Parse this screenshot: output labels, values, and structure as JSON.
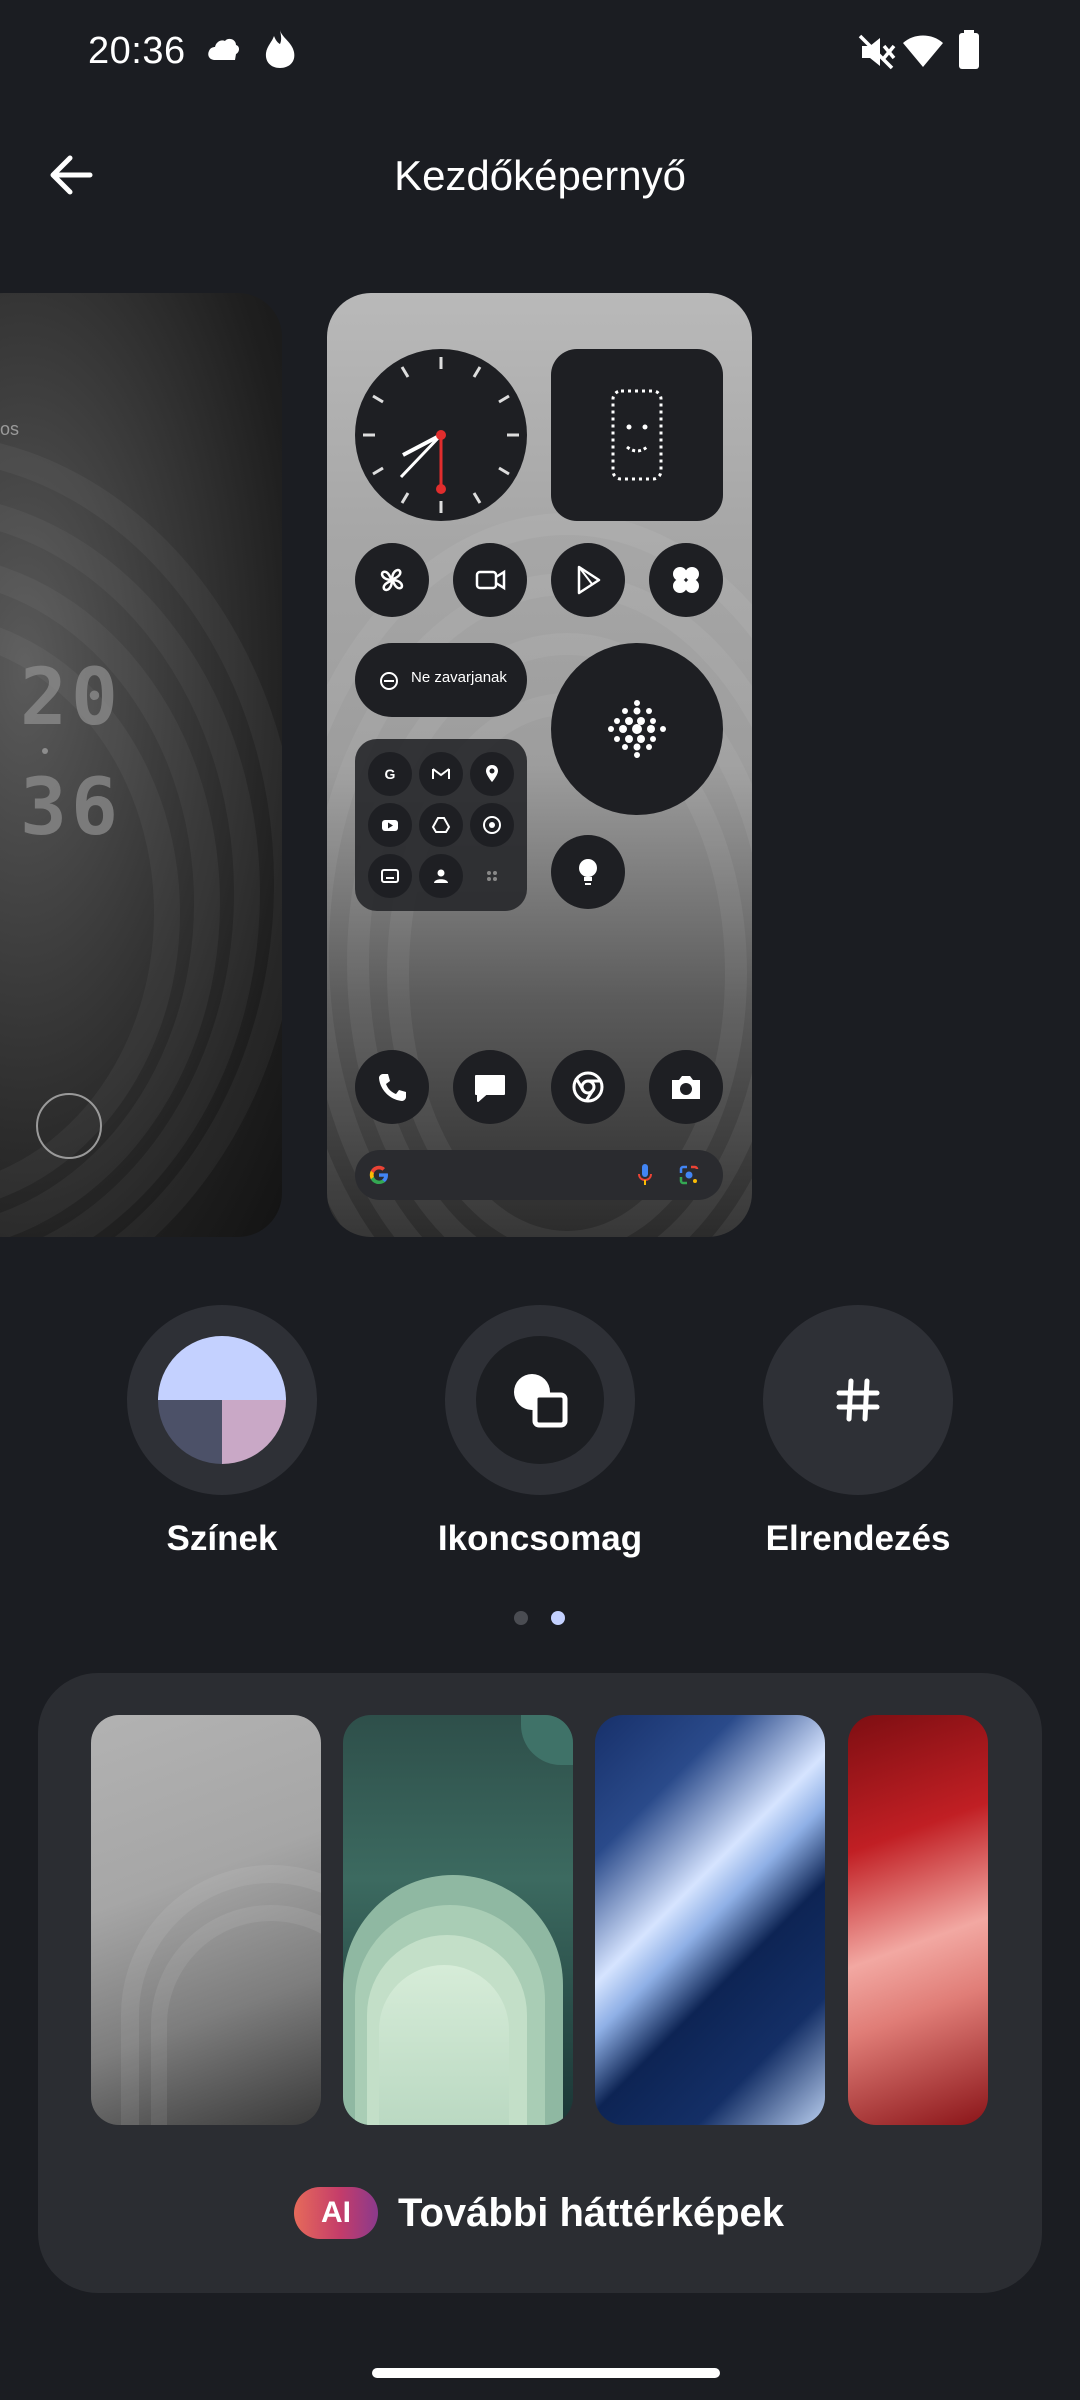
{
  "status_bar": {
    "time": "20:36",
    "left_icons": [
      "cloud-icon",
      "flame-icon"
    ],
    "right_icons": [
      "mute-icon",
      "wifi-icon",
      "battery-icon"
    ]
  },
  "app_bar": {
    "title": "Kezdőképernyő",
    "back_icon": "arrow-back-icon"
  },
  "lock_preview": {
    "text_fragment": "os",
    "clock_digits": [
      "20",
      "36"
    ]
  },
  "home_preview": {
    "dnd_label": "Ne zavarjanak",
    "app_grid_icons": [
      "google-icon",
      "gmail-icon",
      "maps-icon",
      "youtube-icon",
      "drive-icon",
      "music-icon",
      "tv-icon",
      "contacts-icon",
      "more-icon"
    ],
    "shortcut_icons": [
      "fan-icon",
      "video-icon",
      "play-store-icon",
      "nothing-icon"
    ],
    "dock_icons": [
      "phone-icon",
      "messages-icon",
      "chrome-icon",
      "camera-icon"
    ]
  },
  "options": [
    {
      "label": "Színek",
      "icon": "colors-icon"
    },
    {
      "label": "Ikoncsomag",
      "icon": "icon-pack-icon"
    },
    {
      "label": "Elrendezés",
      "icon": "grid-icon"
    }
  ],
  "pager": {
    "count": 2,
    "active": 1
  },
  "wallpapers": {
    "more_label": "További háttérképek",
    "ai_badge": "AI",
    "items": [
      "gray-wave",
      "green-arch",
      "blue-stripe",
      "red-wave"
    ]
  },
  "colors": {
    "background": "#1b1d22",
    "card": "#2b2d32",
    "accent": "#c4d1ff"
  }
}
